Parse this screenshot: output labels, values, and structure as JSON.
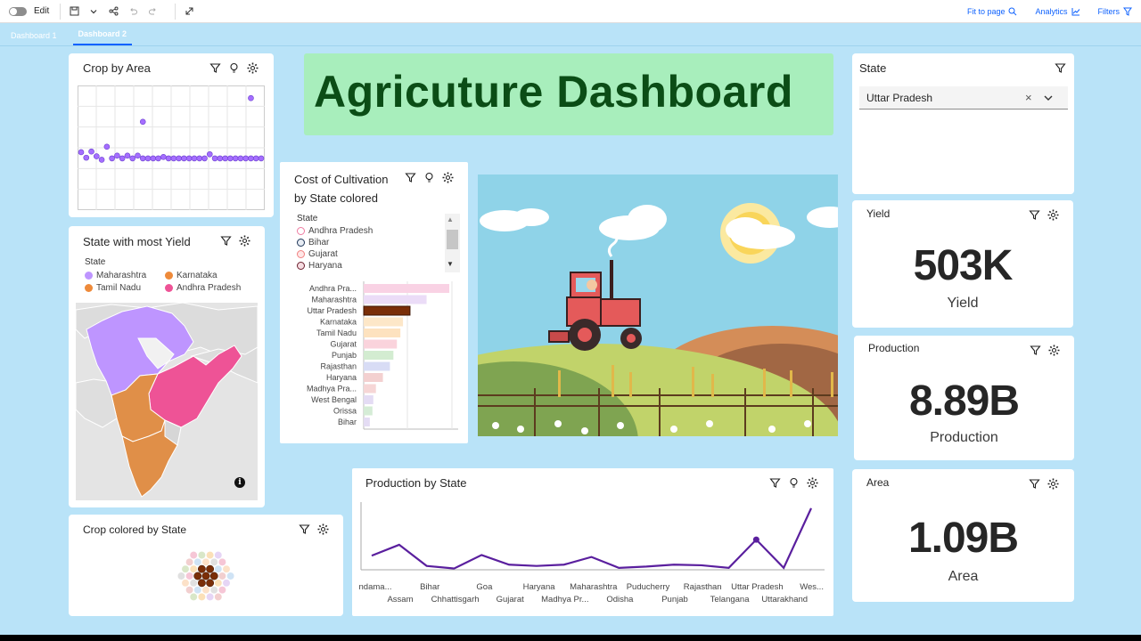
{
  "toolbar": {
    "edit_label": "Edit",
    "fit_label": "Fit to page",
    "analytics_label": "Analytics",
    "filters_label": "Filters"
  },
  "tabs": [
    {
      "label": "Dashboard 1",
      "active": false
    },
    {
      "label": "Dashboard 2",
      "active": true
    }
  ],
  "headline": {
    "title": "Agricuture Dashboard",
    "bg_color": "#a8eebc",
    "text_color": "#0b4d16"
  },
  "crop_by_area": {
    "title": "Crop by Area",
    "chart_data": {
      "type": "scatter",
      "title": "Crop by Area",
      "y": [
        0.52,
        0.44,
        0.53,
        0.46,
        0.41,
        0.6,
        0.43,
        0.47,
        0.43,
        0.47,
        0.43,
        0.47,
        0.43,
        0.43,
        0.43,
        0.43,
        0.45,
        0.43,
        0.43,
        0.43,
        0.43,
        0.43,
        0.43,
        0.43,
        0.43,
        0.49,
        0.43,
        0.43,
        0.43,
        0.43,
        0.43,
        0.43,
        0.43,
        0.43,
        0.43,
        0.43
      ],
      "outliers": [
        {
          "index": 12,
          "y": 0.78
        },
        {
          "index": 33,
          "y": 0.97
        }
      ],
      "grid": true,
      "color": "#a56eff"
    }
  },
  "state_yield": {
    "title": "State with most Yield",
    "legend_title": "State",
    "legend": [
      {
        "label": "Maharashtra",
        "color": "#be95ff"
      },
      {
        "label": "Karnataka",
        "color": "#ee8a3a"
      },
      {
        "label": "Tamil Nadu",
        "color": "#ee8a3a"
      },
      {
        "label": "Andhra Pradesh",
        "color": "#ee5396"
      }
    ],
    "info_icon": "info-icon"
  },
  "cost_cultivation": {
    "title_line1": "Cost of Cultivation",
    "title_line2": "by State colored",
    "legend_title": "State",
    "legend": [
      {
        "label": "Andhra Pradesh",
        "color": "#ff9fbc"
      },
      {
        "label": "Bihar",
        "color": "#1d3557"
      },
      {
        "label": "Gujarat",
        "color": "#ffb3b3"
      },
      {
        "label": "Haryana",
        "color": "#6b1f2e"
      }
    ],
    "chart_data": {
      "type": "bar",
      "orientation": "horizontal",
      "categories": [
        "Andhra Pra...",
        "Maharashtra",
        "Uttar Pradesh",
        "Karnataka",
        "Tamil Nadu",
        "Gujarat",
        "Punjab",
        "Rajasthan",
        "Haryana",
        "Madhya Pra...",
        "West Bengal",
        "Orissa",
        "Bihar"
      ],
      "values": [
        98,
        72,
        53,
        45,
        42,
        38,
        34,
        30,
        22,
        14,
        11,
        10,
        7
      ],
      "colors": [
        "#f9d2e4",
        "#ebdcf7",
        "#7a2e08",
        "#fde7c8",
        "#fde2bf",
        "#fad3dc",
        "#d3ecd1",
        "#d8dcf5",
        "#f3d0d0",
        "#f6d6d6",
        "#e4dcf4",
        "#d5ecd6",
        "#e4dcf4"
      ],
      "highlight": "Uttar Pradesh",
      "xlim": [
        0,
        100
      ]
    }
  },
  "production_by_state": {
    "title": "Production by State",
    "chart_data": {
      "type": "line",
      "title": "Production by State",
      "categories": [
        "Andama...",
        "Assam",
        "Bihar",
        "Chhattisgarh",
        "Goa",
        "Gujarat",
        "Haryana",
        "Madhya Pr...",
        "Maharashtra",
        "Odisha",
        "Puducherry",
        "Punjab",
        "Rajasthan",
        "Telangana",
        "Uttar Pradesh",
        "Uttarakhand",
        "Wes..."
      ],
      "x_labels_row1": [
        "ndama...",
        "Bihar",
        "Goa",
        "Haryana",
        "Maharashtra",
        "Puducherry",
        "Rajasthan",
        "Uttar Pradesh",
        "Wes..."
      ],
      "x_labels_row2": [
        "Assam",
        "Chhattisgarh",
        "Gujarat",
        "Madhya Pr...",
        "Odisha",
        "Punjab",
        "Telangana",
        "Uttarakhand"
      ],
      "values": [
        0.22,
        0.39,
        0.06,
        0.02,
        0.23,
        0.08,
        0.06,
        0.08,
        0.2,
        0.03,
        0.05,
        0.08,
        0.07,
        0.03,
        0.47,
        0.03,
        0.96
      ],
      "highlight_index": 14,
      "ylim": [
        0,
        1
      ],
      "color": "#5a1f9e"
    }
  },
  "crop_colored": {
    "title": "Crop colored by State"
  },
  "state_filter": {
    "title": "State",
    "selected": "Uttar Pradesh"
  },
  "kpi_yield": {
    "title": "Yield",
    "value": "503K",
    "label": "Yield"
  },
  "kpi_production": {
    "title": "Production",
    "value": "8.89B",
    "label": "Production"
  },
  "kpi_area": {
    "title": "Area",
    "value": "1.09B",
    "label": "Area"
  }
}
